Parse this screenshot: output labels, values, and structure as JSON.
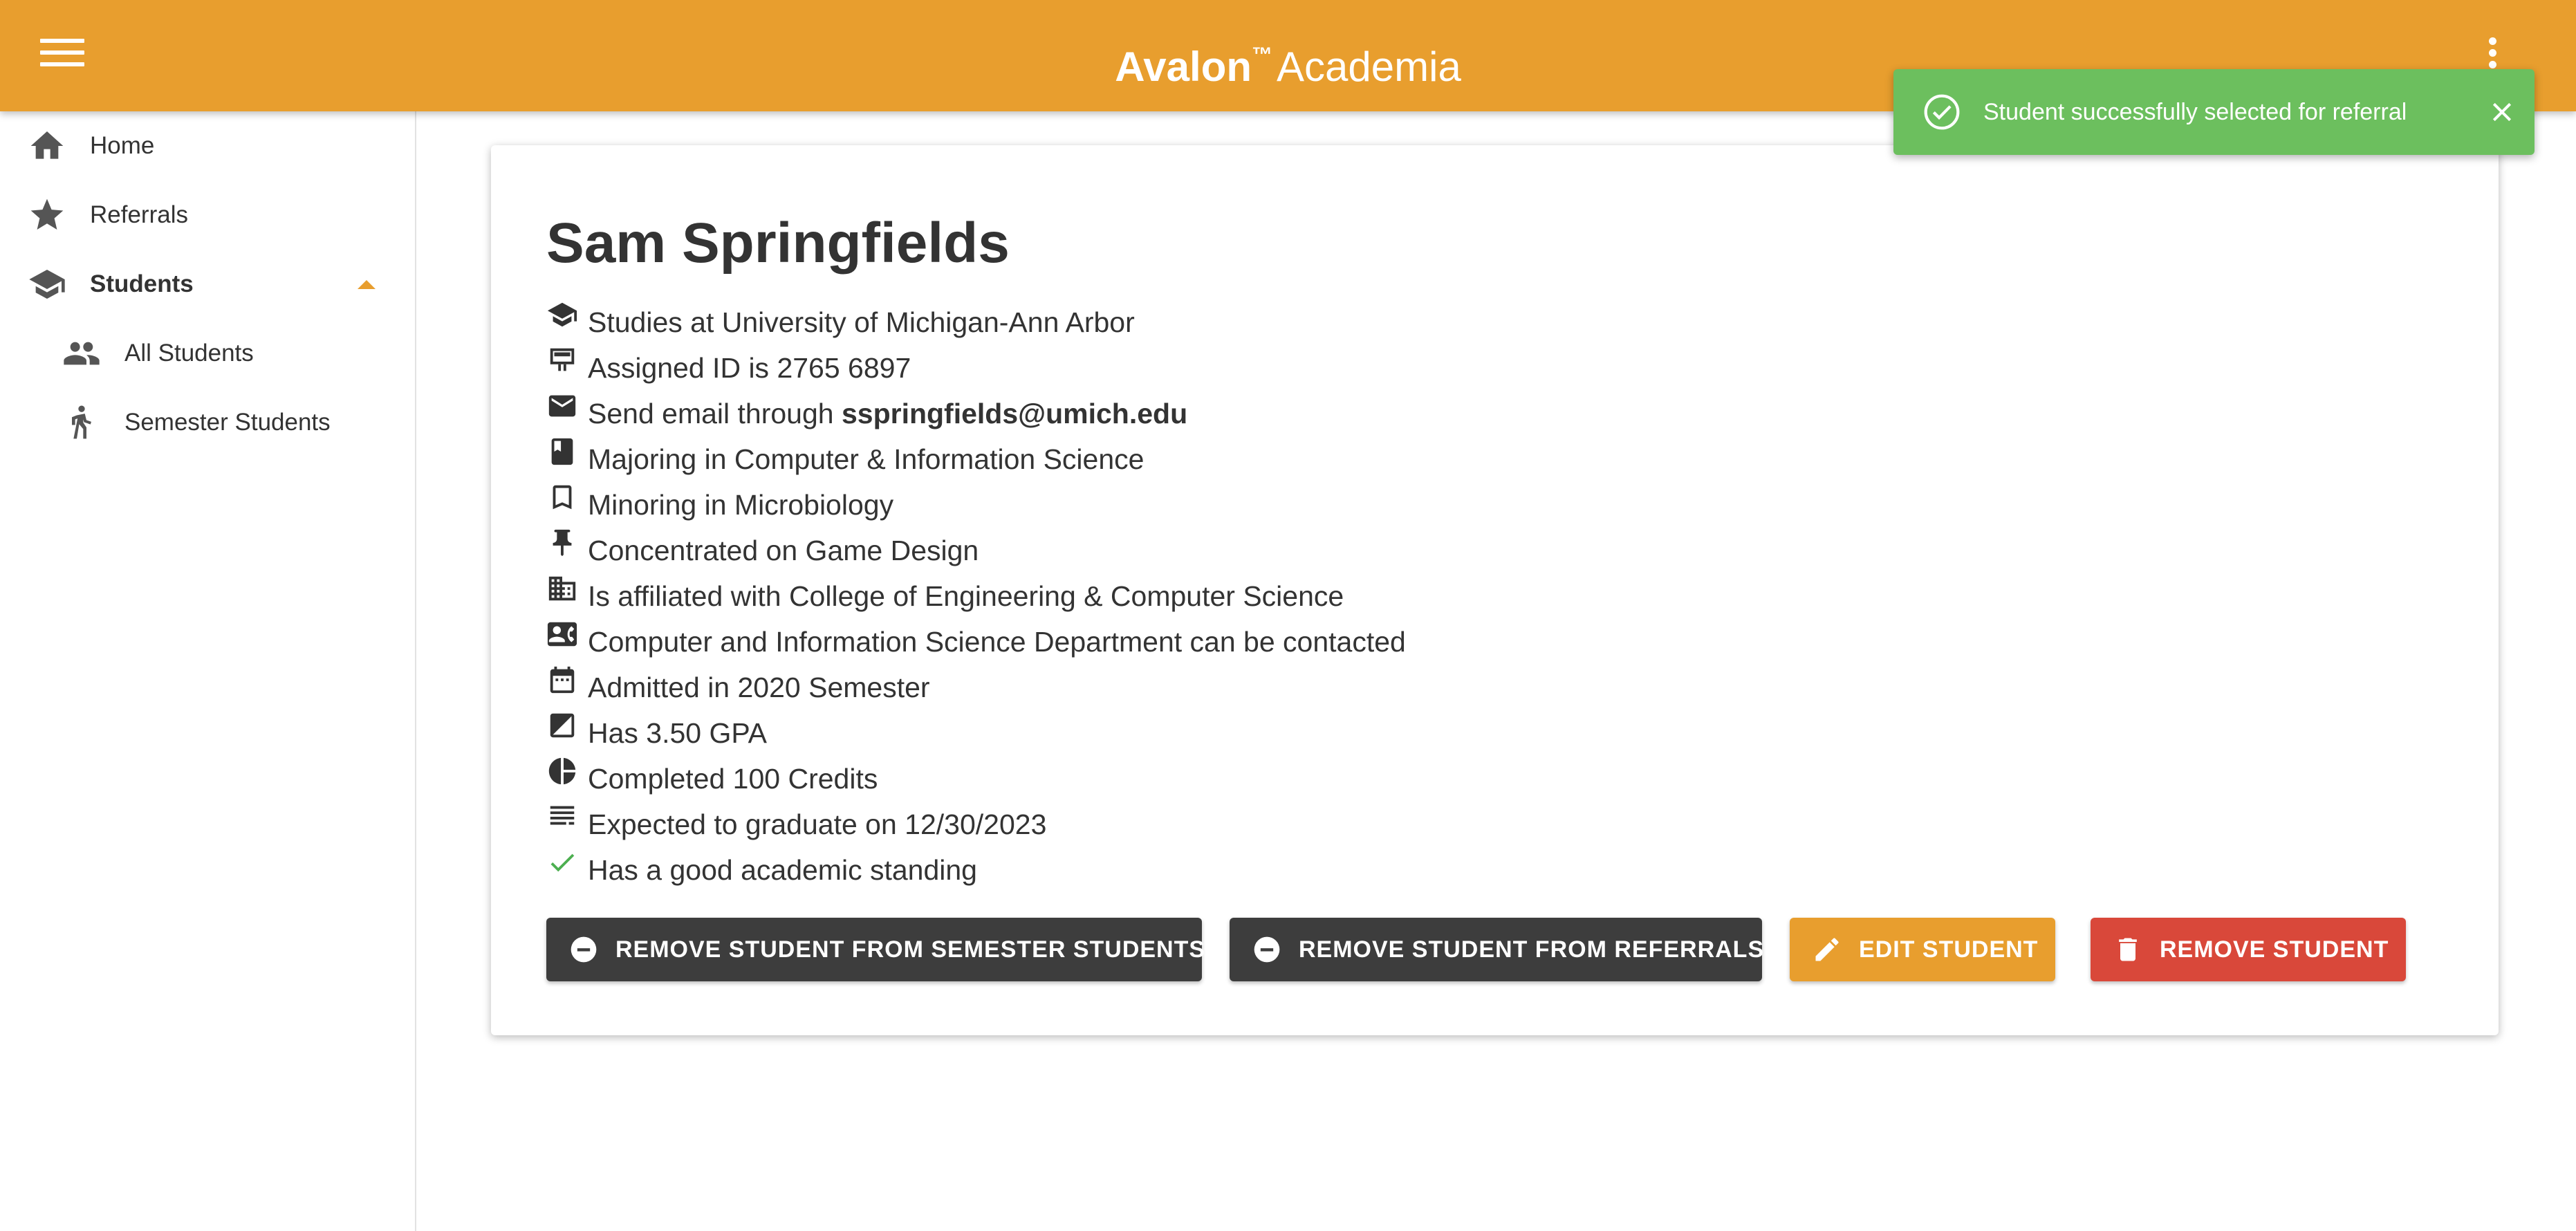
{
  "app": {
    "brand": "Avalon",
    "tm": "™",
    "product": "Academia"
  },
  "sidebar": {
    "items": [
      {
        "label": "Home",
        "icon": "home-icon"
      },
      {
        "label": "Referrals",
        "icon": "star-icon"
      },
      {
        "label": "Students",
        "icon": "school-icon",
        "expanded": true
      },
      {
        "label": "All Students",
        "icon": "people-icon"
      },
      {
        "label": "Semester Students",
        "icon": "person-walking-icon"
      }
    ]
  },
  "student": {
    "name": "Sam Springfields",
    "details": [
      {
        "text": "Studies at University of Michigan-Ann Arbor",
        "icon": "school-icon"
      },
      {
        "text": "Assigned ID is 2765 6897",
        "icon": "badge-icon"
      },
      {
        "prefix": "Send email through ",
        "email": "sspringfields@umich.edu",
        "icon": "email-icon"
      },
      {
        "text": "Majoring in Computer & Information Science",
        "icon": "book-icon"
      },
      {
        "text": "Minoring in Microbiology",
        "icon": "bookmark-icon"
      },
      {
        "text": "Concentrated on Game Design",
        "icon": "push-pin-icon"
      },
      {
        "text": "Is affiliated with College of Engineering & Computer Science",
        "icon": "business-icon"
      },
      {
        "text": "Computer and Information Science Department can be contacted",
        "icon": "contact-card-icon"
      },
      {
        "text": "Admitted in 2020 Semester",
        "icon": "calendar-icon"
      },
      {
        "text": "Has 3.50 GPA",
        "icon": "grade-chart-icon"
      },
      {
        "text": "Completed 100 Credits",
        "icon": "pie-chart-icon"
      },
      {
        "text": "Expected to graduate on 12/30/2023",
        "icon": "list-icon"
      },
      {
        "text": "Has a good academic standing",
        "icon": "check-icon"
      }
    ]
  },
  "actions": {
    "remove_semester": "REMOVE STUDENT FROM SEMESTER STUDENTS",
    "remove_referrals": "REMOVE STUDENT FROM REFERRALS",
    "edit": "EDIT STUDENT",
    "remove": "REMOVE STUDENT"
  },
  "snackbar": {
    "message": "Student successfully selected for referral"
  },
  "colors": {
    "primary": "#E89E2E",
    "success": "#6CBF5E",
    "danger": "#D9483A",
    "dark": "#3D3D3D",
    "check": "#4CAF50"
  }
}
